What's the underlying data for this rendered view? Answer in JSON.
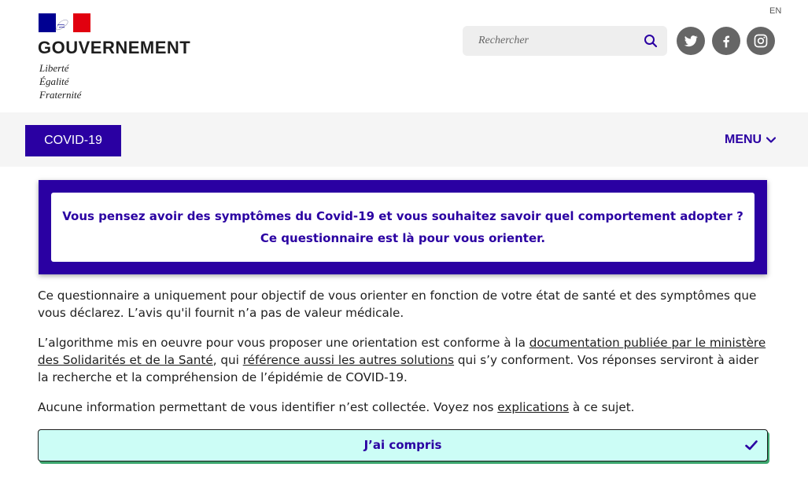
{
  "header": {
    "brand": "GOUVERNEMENT",
    "motto": [
      "Liberté",
      "Égalité",
      "Fraternité"
    ],
    "lang": "EN",
    "search": {
      "placeholder": "Rechercher"
    },
    "social": [
      "twitter-icon",
      "facebook-icon",
      "instagram-icon"
    ]
  },
  "nav": {
    "covid_label": "COVID-19",
    "menu_label": "MENU"
  },
  "banner": {
    "line1": "Vous pensez avoir des symptômes du Covid-19 et vous souhaitez savoir quel comportement adopter ?",
    "line2": "Ce questionnaire est là pour vous orienter."
  },
  "content": {
    "p1": "Ce questionnaire a uniquement pour objectif de vous orienter en fonction de votre état de santé et des symptômes que vous déclarez. L’avis qu'il fournit n’a pas de valeur médicale.",
    "p2_a": "L’algorithme mis en oeuvre pour vous proposer une orientation est conforme à la ",
    "p2_link1": "documentation publiée par le ministère des Solidarités et de la Santé",
    "p2_b": ", qui ",
    "p2_link2": "référence aussi les autres solutions",
    "p2_c": " qui s’y conforment. Vos réponses serviront à aider la recherche et la compréhension de l’épidémie de COVID-19.",
    "p3_a": "Aucune information permettant de vous identifier n’est collectée. Voyez nos ",
    "p3_link": "explications",
    "p3_b": " à ce sujet."
  },
  "action": {
    "understood_label": "J’ai compris"
  },
  "colors": {
    "brand_blue": "#2a00a2",
    "button_bg": "#ccfdf6",
    "button_shadow": "#3ba66e"
  }
}
